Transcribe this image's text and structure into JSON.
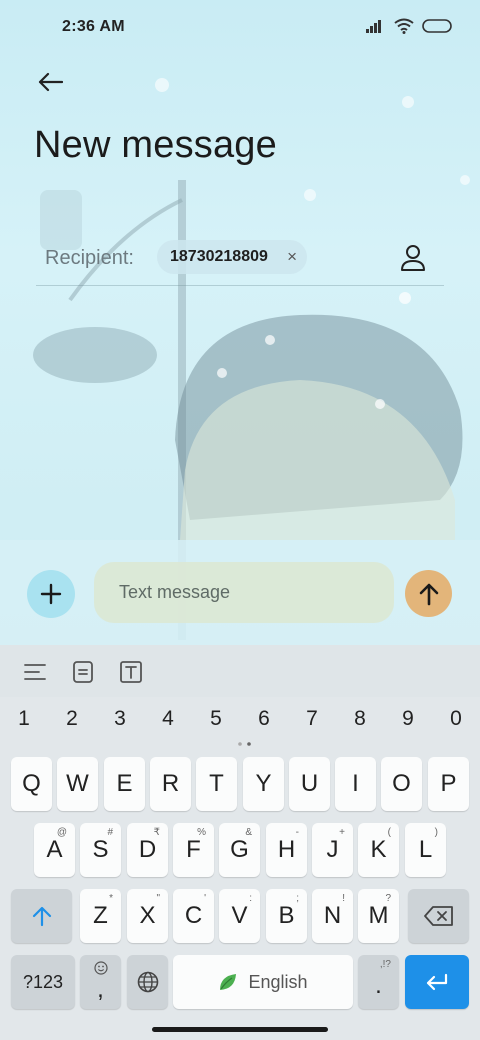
{
  "status_bar": {
    "time": "2:36 AM"
  },
  "header": {
    "title": "New message"
  },
  "recipient": {
    "label": "Recipient:",
    "chip_text": "18730218809",
    "chip_remove": "×"
  },
  "compose": {
    "placeholder": "Text message"
  },
  "keyboard": {
    "numbers": [
      "1",
      "2",
      "3",
      "4",
      "5",
      "6",
      "7",
      "8",
      "9",
      "0"
    ],
    "row1": [
      "Q",
      "W",
      "E",
      "R",
      "T",
      "Y",
      "U",
      "I",
      "O",
      "P"
    ],
    "row2": [
      {
        "key": "A",
        "sup": "@"
      },
      {
        "key": "S",
        "sup": "#"
      },
      {
        "key": "D",
        "sup": "₹"
      },
      {
        "key": "F",
        "sup": "%"
      },
      {
        "key": "G",
        "sup": "&"
      },
      {
        "key": "H",
        "sup": "-"
      },
      {
        "key": "J",
        "sup": "+"
      },
      {
        "key": "K",
        "sup": "("
      },
      {
        "key": "L",
        "sup": ")"
      }
    ],
    "row3": [
      {
        "key": "Z",
        "sup": "*"
      },
      {
        "key": "X",
        "sup": "\""
      },
      {
        "key": "C",
        "sup": "'"
      },
      {
        "key": "V",
        "sup": ":"
      },
      {
        "key": "B",
        "sup": ";"
      },
      {
        "key": "N",
        "sup": "!"
      },
      {
        "key": "M",
        "sup": "?"
      }
    ],
    "symbols_key": "?123",
    "comma_key": ",",
    "space_label": "English",
    "period_key": ".",
    "period_sup": ",!?"
  },
  "colors": {
    "accent": "#1e90e8",
    "send": "#e3b57a",
    "plus": "#a9e2f0"
  }
}
